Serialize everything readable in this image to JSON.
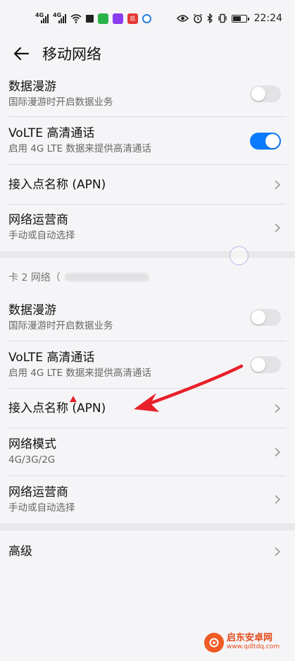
{
  "status_bar": {
    "sim1": "4G",
    "sim2": "4G",
    "time": "22:24",
    "app_badge": "玖"
  },
  "header": {
    "title": "移动网络"
  },
  "sim1": {
    "roaming": {
      "title": "数据漫游",
      "subtitle": "国际漫游时开启数据业务",
      "enabled": false
    },
    "volte": {
      "title": "VoLTE 高清通话",
      "subtitle": "启用 4G LTE 数据来提供高清通话",
      "enabled": true
    },
    "apn": {
      "title": "接入点名称 (APN)"
    },
    "operator": {
      "title": "网络运营商",
      "subtitle": "手动或自动选择"
    }
  },
  "sim2": {
    "header": "卡 2 网络（",
    "roaming": {
      "title": "数据漫游",
      "subtitle": "国际漫游时开启数据业务",
      "enabled": false
    },
    "volte": {
      "title": "VoLTE 高清通话",
      "subtitle": "启用 4G LTE 数据来提供高清通话",
      "enabled": false
    },
    "apn": {
      "title": "接入点名称 (APN)"
    },
    "mode": {
      "title": "网络模式",
      "subtitle": "4G/3G/2G"
    },
    "operator": {
      "title": "网络运营商",
      "subtitle": "手动或自动选择"
    }
  },
  "advanced": {
    "title": "高级"
  },
  "watermark": {
    "name": "启东安卓网",
    "url": "www.qdltdq.com"
  },
  "colors": {
    "accent": "#0a7bff",
    "annotation_arrow": "#e8202a",
    "watermark": "#e44a1b"
  }
}
